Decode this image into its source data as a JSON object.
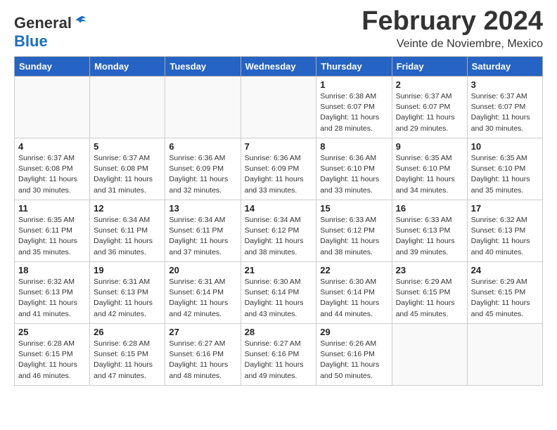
{
  "header": {
    "logo_general": "General",
    "logo_blue": "Blue",
    "month_title": "February 2024",
    "subtitle": "Veinte de Noviembre, Mexico"
  },
  "weekdays": [
    "Sunday",
    "Monday",
    "Tuesday",
    "Wednesday",
    "Thursday",
    "Friday",
    "Saturday"
  ],
  "weeks": [
    [
      {
        "day": "",
        "info": ""
      },
      {
        "day": "",
        "info": ""
      },
      {
        "day": "",
        "info": ""
      },
      {
        "day": "",
        "info": ""
      },
      {
        "day": "1",
        "info": "Sunrise: 6:38 AM\nSunset: 6:07 PM\nDaylight: 11 hours\nand 28 minutes."
      },
      {
        "day": "2",
        "info": "Sunrise: 6:37 AM\nSunset: 6:07 PM\nDaylight: 11 hours\nand 29 minutes."
      },
      {
        "day": "3",
        "info": "Sunrise: 6:37 AM\nSunset: 6:07 PM\nDaylight: 11 hours\nand 30 minutes."
      }
    ],
    [
      {
        "day": "4",
        "info": "Sunrise: 6:37 AM\nSunset: 6:08 PM\nDaylight: 11 hours\nand 30 minutes."
      },
      {
        "day": "5",
        "info": "Sunrise: 6:37 AM\nSunset: 6:08 PM\nDaylight: 11 hours\nand 31 minutes."
      },
      {
        "day": "6",
        "info": "Sunrise: 6:36 AM\nSunset: 6:09 PM\nDaylight: 11 hours\nand 32 minutes."
      },
      {
        "day": "7",
        "info": "Sunrise: 6:36 AM\nSunset: 6:09 PM\nDaylight: 11 hours\nand 33 minutes."
      },
      {
        "day": "8",
        "info": "Sunrise: 6:36 AM\nSunset: 6:10 PM\nDaylight: 11 hours\nand 33 minutes."
      },
      {
        "day": "9",
        "info": "Sunrise: 6:35 AM\nSunset: 6:10 PM\nDaylight: 11 hours\nand 34 minutes."
      },
      {
        "day": "10",
        "info": "Sunrise: 6:35 AM\nSunset: 6:10 PM\nDaylight: 11 hours\nand 35 minutes."
      }
    ],
    [
      {
        "day": "11",
        "info": "Sunrise: 6:35 AM\nSunset: 6:11 PM\nDaylight: 11 hours\nand 35 minutes."
      },
      {
        "day": "12",
        "info": "Sunrise: 6:34 AM\nSunset: 6:11 PM\nDaylight: 11 hours\nand 36 minutes."
      },
      {
        "day": "13",
        "info": "Sunrise: 6:34 AM\nSunset: 6:11 PM\nDaylight: 11 hours\nand 37 minutes."
      },
      {
        "day": "14",
        "info": "Sunrise: 6:34 AM\nSunset: 6:12 PM\nDaylight: 11 hours\nand 38 minutes."
      },
      {
        "day": "15",
        "info": "Sunrise: 6:33 AM\nSunset: 6:12 PM\nDaylight: 11 hours\nand 38 minutes."
      },
      {
        "day": "16",
        "info": "Sunrise: 6:33 AM\nSunset: 6:13 PM\nDaylight: 11 hours\nand 39 minutes."
      },
      {
        "day": "17",
        "info": "Sunrise: 6:32 AM\nSunset: 6:13 PM\nDaylight: 11 hours\nand 40 minutes."
      }
    ],
    [
      {
        "day": "18",
        "info": "Sunrise: 6:32 AM\nSunset: 6:13 PM\nDaylight: 11 hours\nand 41 minutes."
      },
      {
        "day": "19",
        "info": "Sunrise: 6:31 AM\nSunset: 6:13 PM\nDaylight: 11 hours\nand 42 minutes."
      },
      {
        "day": "20",
        "info": "Sunrise: 6:31 AM\nSunset: 6:14 PM\nDaylight: 11 hours\nand 42 minutes."
      },
      {
        "day": "21",
        "info": "Sunrise: 6:30 AM\nSunset: 6:14 PM\nDaylight: 11 hours\nand 43 minutes."
      },
      {
        "day": "22",
        "info": "Sunrise: 6:30 AM\nSunset: 6:14 PM\nDaylight: 11 hours\nand 44 minutes."
      },
      {
        "day": "23",
        "info": "Sunrise: 6:29 AM\nSunset: 6:15 PM\nDaylight: 11 hours\nand 45 minutes."
      },
      {
        "day": "24",
        "info": "Sunrise: 6:29 AM\nSunset: 6:15 PM\nDaylight: 11 hours\nand 45 minutes."
      }
    ],
    [
      {
        "day": "25",
        "info": "Sunrise: 6:28 AM\nSunset: 6:15 PM\nDaylight: 11 hours\nand 46 minutes."
      },
      {
        "day": "26",
        "info": "Sunrise: 6:28 AM\nSunset: 6:15 PM\nDaylight: 11 hours\nand 47 minutes."
      },
      {
        "day": "27",
        "info": "Sunrise: 6:27 AM\nSunset: 6:16 PM\nDaylight: 11 hours\nand 48 minutes."
      },
      {
        "day": "28",
        "info": "Sunrise: 6:27 AM\nSunset: 6:16 PM\nDaylight: 11 hours\nand 49 minutes."
      },
      {
        "day": "29",
        "info": "Sunrise: 6:26 AM\nSunset: 6:16 PM\nDaylight: 11 hours\nand 50 minutes."
      },
      {
        "day": "",
        "info": ""
      },
      {
        "day": "",
        "info": ""
      }
    ]
  ]
}
